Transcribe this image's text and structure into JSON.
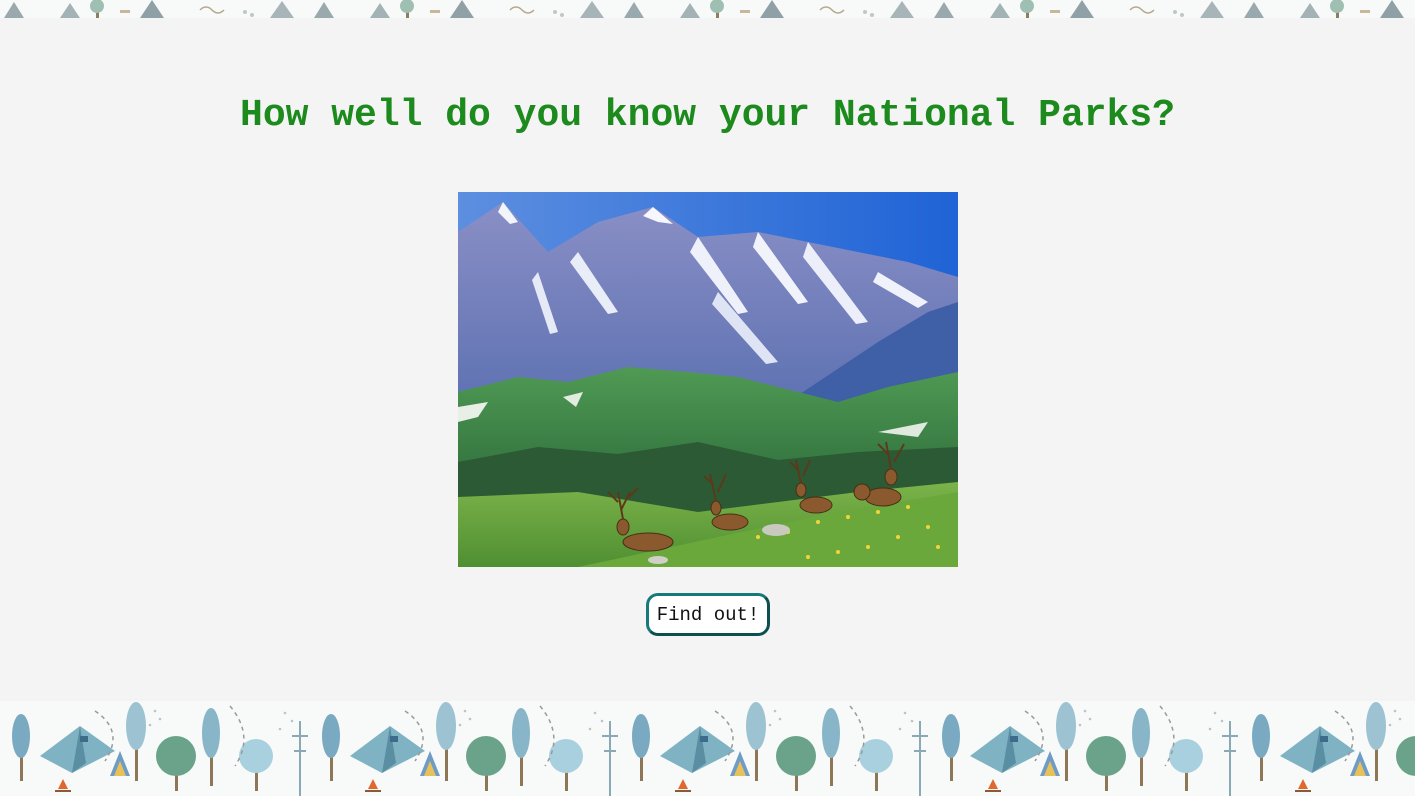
{
  "page": {
    "heading": "How well do you know your National Parks?",
    "hero_image_alt": "Elk resting on an alpine meadow below snowy mountains",
    "cta_label": "Find out!"
  },
  "colors": {
    "heading": "#1c8a1c",
    "panel_background": "#f4f4f4",
    "button_border": "#167a7a"
  },
  "decorations": {
    "top_border": "forest-camping-pattern",
    "bottom_border": "forest-camping-pattern"
  }
}
